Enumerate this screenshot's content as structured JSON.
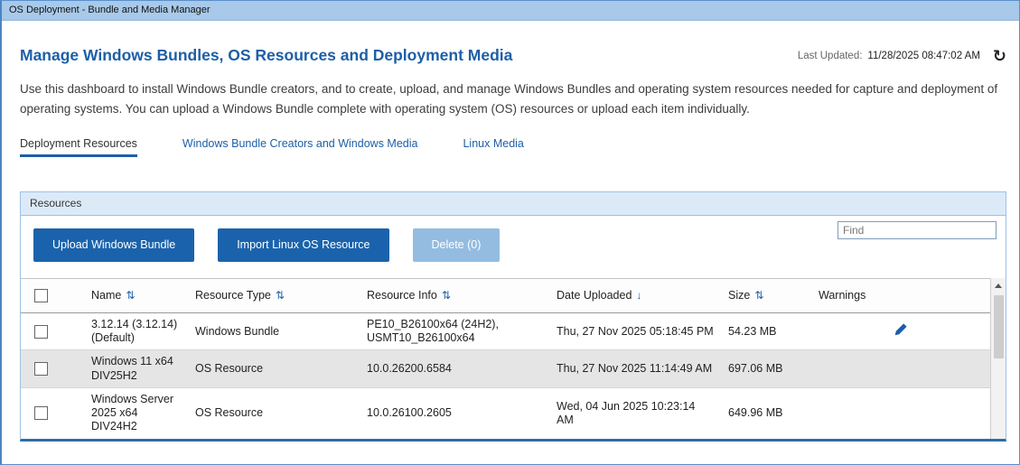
{
  "window": {
    "title": "OS Deployment - Bundle and Media Manager"
  },
  "header": {
    "title": "Manage Windows Bundles, OS Resources and Deployment Media",
    "last_updated_label": "Last Updated:",
    "last_updated_value": "11/28/2025 08:47:02 AM"
  },
  "description": "Use this dashboard to install Windows Bundle creators, and to create, upload, and manage Windows Bundles and operating system resources needed for capture and deployment of operating systems. You can upload a Windows Bundle complete with operating system (OS) resources or upload each item individually.",
  "tabs": [
    {
      "label": "Deployment Resources",
      "active": true
    },
    {
      "label": "Windows Bundle Creators and Windows Media",
      "active": false
    },
    {
      "label": "Linux Media",
      "active": false
    }
  ],
  "resources_panel": {
    "title": "Resources",
    "upload_button": "Upload Windows Bundle",
    "import_button": "Import Linux OS Resource",
    "delete_button": "Delete (0)",
    "find_placeholder": "Find"
  },
  "table": {
    "columns": {
      "name": "Name",
      "resource_type": "Resource Type",
      "resource_info": "Resource Info",
      "date_uploaded": "Date Uploaded",
      "size": "Size",
      "warnings": "Warnings"
    },
    "rows": [
      {
        "name": "3.12.14 (3.12.14) (Default)",
        "resource_type": "Windows Bundle",
        "resource_info": "PE10_B26100x64 (24H2), USMT10_B26100x64",
        "date_uploaded": "Thu, 27 Nov 2025 05:18:45 PM",
        "size": "54.23 MB",
        "warnings_icon": "edit-icon"
      },
      {
        "name": "Windows 11 x64 DIV25H2",
        "resource_type": "OS Resource",
        "resource_info": "10.0.26200.6584",
        "date_uploaded": "Thu, 27 Nov 2025 11:14:49 AM",
        "size": "697.06 MB",
        "warnings_icon": ""
      },
      {
        "name": "Windows Server 2025 x64 DIV24H2",
        "resource_type": "OS Resource",
        "resource_info": "10.0.26100.2605",
        "date_uploaded": "Wed, 04 Jun 2025 10:23:14 AM",
        "size": "649.96 MB",
        "warnings_icon": ""
      }
    ]
  },
  "icons": {
    "refresh": "↻",
    "sort": "⇅",
    "sort_desc": "↓"
  },
  "colors": {
    "accent_blue": "#1a63ac",
    "titlebar_blue": "#a8c9e9",
    "panel_header_blue": "#dceaf8",
    "disabled_button_blue": "#93bce0",
    "link_blue": "#1d5fa7"
  }
}
